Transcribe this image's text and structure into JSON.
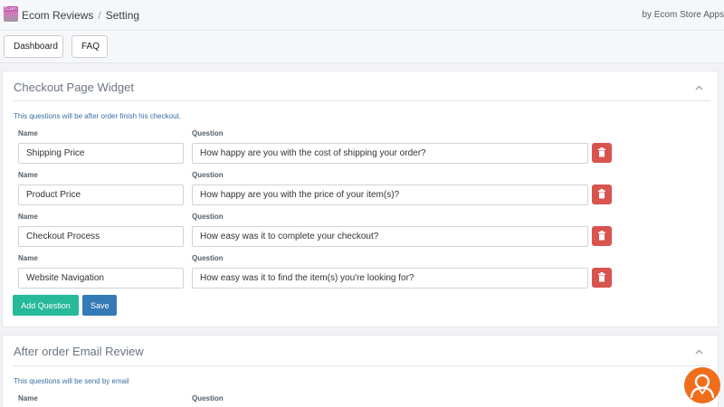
{
  "header": {
    "logo_text": "Ecom",
    "breadcrumb_app": "Ecom Reviews",
    "breadcrumb_separator": "/",
    "breadcrumb_page": "Setting",
    "byline": "by Ecom Store Apps"
  },
  "nav": {
    "dashboard_label": "Dashboard",
    "faq_label": "FAQ"
  },
  "checkout_widget": {
    "title": "Checkout Page Widget",
    "description": "This questions will be after order finish his checkout.",
    "name_header": "Name",
    "question_header": "Question",
    "rows": [
      {
        "name": "Shipping Price",
        "question": "How happy are you with the cost of shipping your order?"
      },
      {
        "name": "Product Price",
        "question": "How happy are you with the price of your item(s)?"
      },
      {
        "name": "Checkout Process",
        "question": "How easy was it to complete your checkout?"
      },
      {
        "name": "Website Navigation",
        "question": "How easy was it to find the item(s) you're looking for?"
      }
    ],
    "add_question_label": "Add Question",
    "save_label": "Save"
  },
  "email_review": {
    "title": "After order Email Review",
    "description": "This questions will be send by email",
    "name_header": "Name",
    "question_header": "Question"
  },
  "icons": {
    "collapse": "chevron-up-icon",
    "delete": "trash-icon",
    "chat": "user-support-icon"
  },
  "colors": {
    "add_button": "#26b99a",
    "save_button": "#337ab7",
    "delete_button": "#d9534f",
    "chat_widget": "#f06d1b",
    "description_text": "#3b6ea5"
  }
}
